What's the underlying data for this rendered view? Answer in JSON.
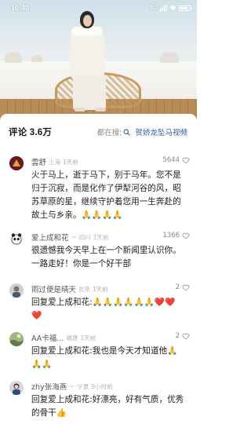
{
  "status_bar": {
    "time": "10:40",
    "network": "5G",
    "battery": ""
  },
  "header": {
    "count_label": "评论 3.6万",
    "search_prefix": "都在搜:",
    "search_keyword": "贺娇龙坠马视频"
  },
  "comments": [
    {
      "name": "雲舒",
      "location": "上海",
      "time_ago": "1天前",
      "likes": "5644",
      "text": "火于马上，逝于马下，别于马年。您不是归于沉寂，而是化作了伊犁河谷的风，昭苏草原的星，继续守护着您用一生奔赴的故土与乡亲。🙏🙏🙏🙏"
    },
    {
      "name": "爱上成和花",
      "location": "四川",
      "time_ago": "1天前",
      "likes": "1366",
      "text": "很遗憾我今天早上在一个新闻里认识你。一路走好！你是一个好干部"
    },
    {
      "name": "雨过便是晴天",
      "location": "北京",
      "time_ago": "1天前",
      "likes": "2",
      "text": "回复爱上成和花:🙏🙏🙏🙏🙏🙏❤️❤️❤️"
    },
    {
      "name": "AA卡福...",
      "location": "福建",
      "time_ago": "1天前",
      "likes": "2",
      "text": "回复爱上成和花:我也是今天才知道他🙏🙏🙏"
    },
    {
      "name": "zhy张海燕",
      "location": "宁夏",
      "time_ago": "9小时前",
      "likes": "",
      "text": "回复爱上成和花:好漂亮，好有气质，优秀的骨干👍"
    }
  ],
  "colors": {
    "accent_link": "#2d5c9e",
    "meta_gray": "#b2b2b2"
  },
  "icons": [
    "signal-icon",
    "wifi-icon",
    "battery-icon",
    "search-icon",
    "like-icon",
    "vip-badge-icon"
  ]
}
